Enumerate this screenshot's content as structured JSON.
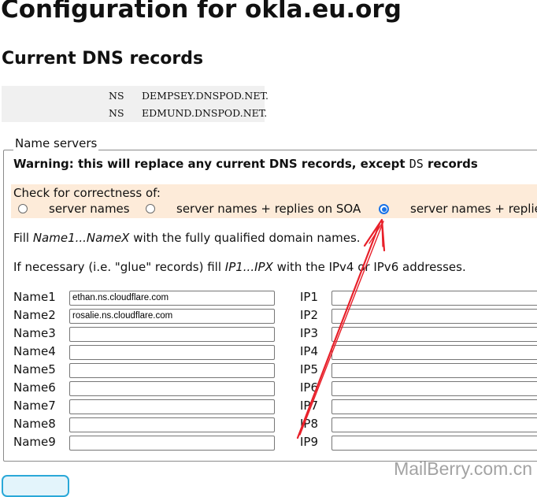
{
  "page_title": "Configuration for okla.eu.org",
  "section_title": "Current DNS records",
  "dns_records": [
    {
      "type": "NS",
      "value": "DEMPSEY.DNSPOD.NET."
    },
    {
      "type": "NS",
      "value": "EDMUND.DNSPOD.NET."
    }
  ],
  "nameservers_form": {
    "legend": "Name servers",
    "warning_prefix": "Warning: this will replace any current DNS records, except ",
    "warning_code": "DS",
    "warning_suffix": " records",
    "check_label": "Check for correctness of:",
    "radio_options": [
      {
        "label": "server names",
        "checked": false
      },
      {
        "label": "server names + replies on SOA",
        "checked": false
      },
      {
        "label": "server names + replies",
        "checked": true
      }
    ],
    "fill_text": {
      "pre": "Fill ",
      "name_range": "Name1...NameX",
      "post": " with the fully qualified domain names."
    },
    "glue_text": {
      "pre": "If necessary (i.e. \"glue\" records) fill ",
      "ip_range": "IP1...IPX",
      "post": " with the IPv4 or IPv6 addresses."
    },
    "rows": [
      {
        "name_label": "Name1",
        "name_value": "ethan.ns.cloudflare.com",
        "ip_label": "IP1",
        "ip_value": ""
      },
      {
        "name_label": "Name2",
        "name_value": "rosalie.ns.cloudflare.com",
        "ip_label": "IP2",
        "ip_value": ""
      },
      {
        "name_label": "Name3",
        "name_value": "",
        "ip_label": "IP3",
        "ip_value": ""
      },
      {
        "name_label": "Name4",
        "name_value": "",
        "ip_label": "IP4",
        "ip_value": ""
      },
      {
        "name_label": "Name5",
        "name_value": "",
        "ip_label": "IP5",
        "ip_value": ""
      },
      {
        "name_label": "Name6",
        "name_value": "",
        "ip_label": "IP6",
        "ip_value": ""
      },
      {
        "name_label": "Name7",
        "name_value": "",
        "ip_label": "IP7",
        "ip_value": ""
      },
      {
        "name_label": "Name8",
        "name_value": "",
        "ip_label": "IP8",
        "ip_value": ""
      },
      {
        "name_label": "Name9",
        "name_value": "",
        "ip_label": "IP9",
        "ip_value": ""
      }
    ]
  },
  "watermark": "MailBerry.com.cn",
  "colors": {
    "annotation_arrow": "#e8202a",
    "check_bg": "#fdebd9",
    "radio_accent": "#1a73e8"
  }
}
